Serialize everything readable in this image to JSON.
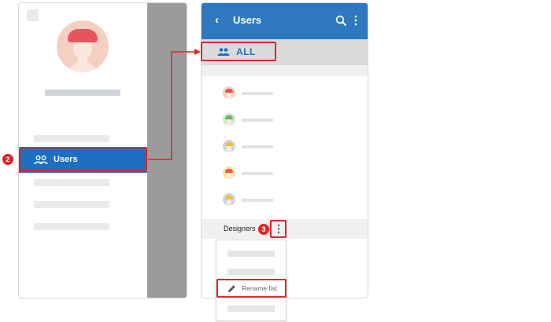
{
  "drawer": {
    "items": [
      {
        "label": "Users",
        "icon": "group-icon",
        "selected": true
      }
    ]
  },
  "users_screen": {
    "title": "Users",
    "all_tab": {
      "label": "ALL",
      "icon": "group-icon"
    },
    "user_avatars": [
      {
        "hair": "#d9544d",
        "skin": "#f4cfc2"
      },
      {
        "hair": "#67b36a",
        "skin": "#cfe8cd"
      },
      {
        "hair": "#f2c230",
        "skin": "#cdd2ee"
      },
      {
        "hair": "#e8545c",
        "skin": "#fde39a"
      },
      {
        "hair": "#f2c230",
        "skin": "#cdd2ee"
      }
    ],
    "group": {
      "label": "Designers"
    }
  },
  "context_menu": {
    "items": [
      {
        "label": ""
      },
      {
        "label": ""
      },
      {
        "label": "Rename list",
        "icon": "pencil-icon"
      },
      {
        "label": ""
      }
    ]
  },
  "callouts": {
    "step2": "2",
    "step3": "3"
  },
  "colors": {
    "accent": "#1e6fc0",
    "appbar": "#2e78bf",
    "callout": "#e0242a"
  }
}
